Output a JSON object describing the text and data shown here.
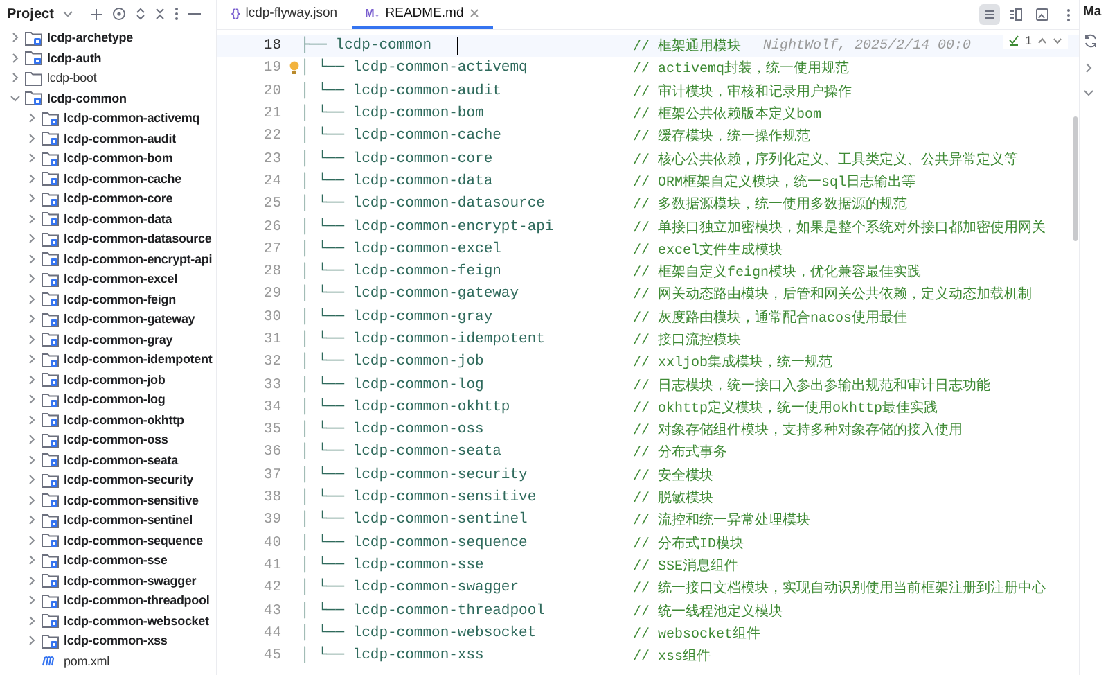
{
  "sidebar": {
    "title": "Project",
    "tree": [
      {
        "label": "lcdp-archetype",
        "kind": "module",
        "expanded": false
      },
      {
        "label": "lcdp-auth",
        "kind": "module",
        "expanded": false
      },
      {
        "label": "lcdp-boot",
        "kind": "folder",
        "expanded": false
      },
      {
        "label": "lcdp-common",
        "kind": "module",
        "expanded": true,
        "children": [
          {
            "label": "lcdp-common-activemq",
            "kind": "module",
            "expanded": false
          },
          {
            "label": "lcdp-common-audit",
            "kind": "module",
            "expanded": false
          },
          {
            "label": "lcdp-common-bom",
            "kind": "module",
            "expanded": false
          },
          {
            "label": "lcdp-common-cache",
            "kind": "module",
            "expanded": false
          },
          {
            "label": "lcdp-common-core",
            "kind": "module",
            "expanded": false
          },
          {
            "label": "lcdp-common-data",
            "kind": "module",
            "expanded": false
          },
          {
            "label": "lcdp-common-datasource",
            "kind": "module",
            "expanded": false
          },
          {
            "label": "lcdp-common-encrypt-api",
            "kind": "module",
            "expanded": false
          },
          {
            "label": "lcdp-common-excel",
            "kind": "module",
            "expanded": false
          },
          {
            "label": "lcdp-common-feign",
            "kind": "module",
            "expanded": false
          },
          {
            "label": "lcdp-common-gateway",
            "kind": "module",
            "expanded": false
          },
          {
            "label": "lcdp-common-gray",
            "kind": "module",
            "expanded": false
          },
          {
            "label": "lcdp-common-idempotent",
            "kind": "module",
            "expanded": false
          },
          {
            "label": "lcdp-common-job",
            "kind": "module",
            "expanded": false
          },
          {
            "label": "lcdp-common-log",
            "kind": "module",
            "expanded": false
          },
          {
            "label": "lcdp-common-okhttp",
            "kind": "module",
            "expanded": false
          },
          {
            "label": "lcdp-common-oss",
            "kind": "module",
            "expanded": false
          },
          {
            "label": "lcdp-common-seata",
            "kind": "module",
            "expanded": false
          },
          {
            "label": "lcdp-common-security",
            "kind": "module",
            "expanded": false
          },
          {
            "label": "lcdp-common-sensitive",
            "kind": "module",
            "expanded": false
          },
          {
            "label": "lcdp-common-sentinel",
            "kind": "module",
            "expanded": false
          },
          {
            "label": "lcdp-common-sequence",
            "kind": "module",
            "expanded": false
          },
          {
            "label": "lcdp-common-sse",
            "kind": "module",
            "expanded": false
          },
          {
            "label": "lcdp-common-swagger",
            "kind": "module",
            "expanded": false
          },
          {
            "label": "lcdp-common-threadpool",
            "kind": "module",
            "expanded": false
          },
          {
            "label": "lcdp-common-websocket",
            "kind": "module",
            "expanded": false
          },
          {
            "label": "lcdp-common-xss",
            "kind": "module",
            "expanded": false
          },
          {
            "label": "pom.xml",
            "kind": "maven-file"
          }
        ]
      }
    ]
  },
  "tabs": [
    {
      "badge": "{}",
      "label": "lcdp-flyway.json",
      "selected": false
    },
    {
      "badge": "M↓",
      "label": "README.md",
      "selected": true
    }
  ],
  "view_modes": [
    {
      "kind": "editor",
      "selected": true
    },
    {
      "kind": "split",
      "selected": false
    },
    {
      "kind": "preview",
      "selected": false
    }
  ],
  "inspection": {
    "count": "1"
  },
  "lines": [
    {
      "number": "18",
      "code": "├── lcdp-common",
      "comment": "// 框架通用模块",
      "current": true,
      "blame": "NightWolf, 2025/2/14 00:0",
      "bulb": false
    },
    {
      "number": "19",
      "code": "│      └── lcdp-common-activemq",
      "comment": "// activemq封装，统一使用规范",
      "current": false,
      "bulb": true
    },
    {
      "number": "20",
      "code": "│      └── lcdp-common-audit",
      "comment": "// 审计模块，审核和记录用户操作",
      "current": false,
      "bulb": false
    },
    {
      "number": "21",
      "code": "│      └── lcdp-common-bom",
      "comment": "// 框架公共依赖版本定义bom",
      "current": false,
      "bulb": false
    },
    {
      "number": "22",
      "code": "│      └── lcdp-common-cache",
      "comment": "// 缓存模块，统一操作规范",
      "current": false,
      "bulb": false
    },
    {
      "number": "23",
      "code": "│      └── lcdp-common-core",
      "comment": "// 核心公共依赖，序列化定义、工具类定义、公共异常定义等",
      "current": false,
      "bulb": false
    },
    {
      "number": "24",
      "code": "│      └── lcdp-common-data",
      "comment": "// ORM框架自定义模块，统一sql日志输出等",
      "current": false,
      "bulb": false
    },
    {
      "number": "25",
      "code": "│      └── lcdp-common-datasource",
      "comment": "// 多数据源模块，统一使用多数据源的规范",
      "current": false,
      "bulb": false
    },
    {
      "number": "26",
      "code": "│      └── lcdp-common-encrypt-api",
      "comment": "// 单接口独立加密模块，如果是整个系统对外接口都加密使用网关",
      "current": false,
      "bulb": false
    },
    {
      "number": "27",
      "code": "│      └── lcdp-common-excel",
      "comment": "// excel文件生成模块",
      "current": false,
      "bulb": false
    },
    {
      "number": "28",
      "code": "│      └── lcdp-common-feign",
      "comment": "// 框架自定义feign模块，优化兼容最佳实践",
      "current": false,
      "bulb": false
    },
    {
      "number": "29",
      "code": "│      └── lcdp-common-gateway",
      "comment": "// 网关动态路由模块，后管和网关公共依赖，定义动态加载机制",
      "current": false,
      "bulb": false
    },
    {
      "number": "30",
      "code": "│      └── lcdp-common-gray",
      "comment": "// 灰度路由模块，通常配合nacos使用最佳",
      "current": false,
      "bulb": false
    },
    {
      "number": "31",
      "code": "│      └── lcdp-common-idempotent",
      "comment": "// 接口流控模块",
      "current": false,
      "bulb": false
    },
    {
      "number": "32",
      "code": "│      └── lcdp-common-job",
      "comment": "// xxljob集成模块，统一规范",
      "current": false,
      "bulb": false
    },
    {
      "number": "33",
      "code": "│      └── lcdp-common-log",
      "comment": "// 日志模块，统一接口入参出参输出规范和审计日志功能",
      "current": false,
      "bulb": false
    },
    {
      "number": "34",
      "code": "│      └── lcdp-common-okhttp",
      "comment": "// okhttp定义模块，统一使用okhttp最佳实践",
      "current": false,
      "bulb": false
    },
    {
      "number": "35",
      "code": "│      └── lcdp-common-oss",
      "comment": "// 对象存储组件模块，支持多种对象存储的接入使用",
      "current": false,
      "bulb": false
    },
    {
      "number": "36",
      "code": "│      └── lcdp-common-seata",
      "comment": "// 分布式事务",
      "current": false,
      "bulb": false
    },
    {
      "number": "37",
      "code": "│      └── lcdp-common-security",
      "comment": "// 安全模块",
      "current": false,
      "bulb": false
    },
    {
      "number": "38",
      "code": "│      └── lcdp-common-sensitive",
      "comment": "// 脱敏模块",
      "current": false,
      "bulb": false
    },
    {
      "number": "39",
      "code": "│      └── lcdp-common-sentinel",
      "comment": "// 流控和统一异常处理模块",
      "current": false,
      "bulb": false
    },
    {
      "number": "40",
      "code": "│      └── lcdp-common-sequence",
      "comment": "// 分布式ID模块",
      "current": false,
      "bulb": false
    },
    {
      "number": "41",
      "code": "│      └── lcdp-common-sse",
      "comment": "// SSE消息组件",
      "current": false,
      "bulb": false
    },
    {
      "number": "42",
      "code": "│      └── lcdp-common-swagger",
      "comment": "// 统一接口文档模块，实现自动识别使用当前框架注册到注册中心",
      "current": false,
      "bulb": false
    },
    {
      "number": "43",
      "code": "│      └── lcdp-common-threadpool",
      "comment": "// 统一线程池定义模块",
      "current": false,
      "bulb": false
    },
    {
      "number": "44",
      "code": "│      └── lcdp-common-websocket",
      "comment": "// websocket组件",
      "current": false,
      "bulb": false
    },
    {
      "number": "45",
      "code": "│      └── lcdp-common-xss",
      "comment": "// xss组件",
      "current": false,
      "bulb": false
    }
  ],
  "right_panel": {
    "title": "Ma"
  }
}
